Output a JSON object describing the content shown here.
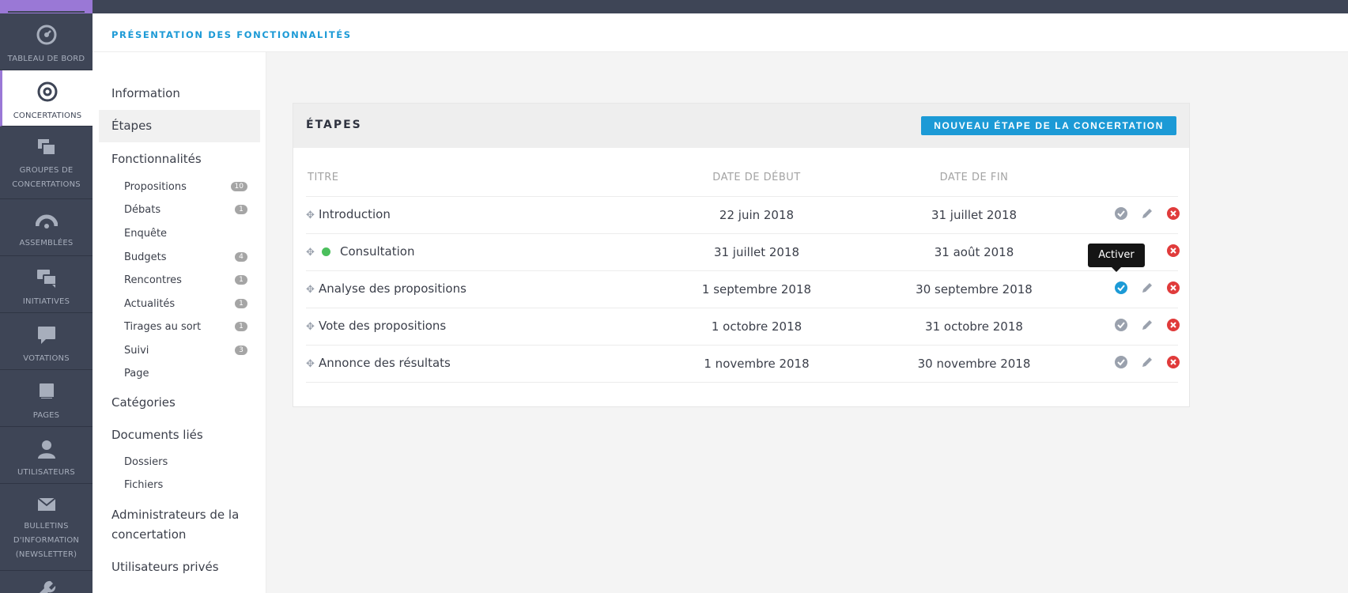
{
  "header": {
    "breadcrumb": "Présentation des fonctionnalités"
  },
  "leftnav": {
    "items": [
      {
        "label": "Tableau de bord",
        "icon": "dashboard-icon"
      },
      {
        "label": "Concertations",
        "icon": "target-icon",
        "active": true
      },
      {
        "label": "Groupes de concertations",
        "icon": "stack-icon"
      },
      {
        "label": "Assemblées",
        "icon": "assembly-icon"
      },
      {
        "label": "Initiatives",
        "icon": "chat-bubbles-icon"
      },
      {
        "label": "Votations",
        "icon": "speech-bubble-icon"
      },
      {
        "label": "Pages",
        "icon": "book-icon"
      },
      {
        "label": "Utilisateurs",
        "icon": "user-icon"
      },
      {
        "label": "Bulletins d'information (newsletter)",
        "icon": "envelope-icon"
      },
      {
        "label": "",
        "icon": "wrench-icon"
      }
    ]
  },
  "subnav": {
    "information": "Information",
    "etapes": "Étapes",
    "fonctionnalites": "Fonctionnalités",
    "features": [
      {
        "label": "Propositions",
        "badge": "10"
      },
      {
        "label": "Débats",
        "badge": "1"
      },
      {
        "label": "Enquête",
        "badge": ""
      },
      {
        "label": "Budgets",
        "badge": "4"
      },
      {
        "label": "Rencontres",
        "badge": "1"
      },
      {
        "label": "Actualités",
        "badge": "1"
      },
      {
        "label": "Tirages au sort",
        "badge": "1"
      },
      {
        "label": "Suivi",
        "badge": "3"
      },
      {
        "label": "Page",
        "badge": ""
      }
    ],
    "categories": "Catégories",
    "documents": "Documents liés",
    "doc_items": [
      "Dossiers",
      "Fichiers"
    ],
    "admins": "Administrateurs de la concertation",
    "private_users": "Utilisateurs privés"
  },
  "panel": {
    "title": "Étapes",
    "new_button": "Nouveau étape de la concertation",
    "columns": {
      "title": "Titre",
      "start": "Date de début",
      "end": "Date de fin"
    },
    "rows": [
      {
        "title": "Introduction",
        "start": "22 juin 2018",
        "end": "31 juillet 2018",
        "active": false
      },
      {
        "title": "Consultation",
        "start": "31 juillet 2018",
        "end": "31 août 2018",
        "active": true
      },
      {
        "title": "Analyse des propositions",
        "start": "1 septembre 2018",
        "end": "30 septembre 2018",
        "active": false
      },
      {
        "title": "Vote des propositions",
        "start": "1 octobre 2018",
        "end": "31 octobre 2018",
        "active": false
      },
      {
        "title": "Annonce des résultats",
        "start": "1 novembre 2018",
        "end": "30 novembre 2018",
        "active": false
      }
    ],
    "tooltip": "Activer"
  },
  "colors": {
    "nav_bg": "#3e4556",
    "accent_purple": "#9a78d6",
    "primary_blue": "#1c9ad6",
    "active_green": "#4bbf5c",
    "delete_red": "#e03b3b"
  }
}
